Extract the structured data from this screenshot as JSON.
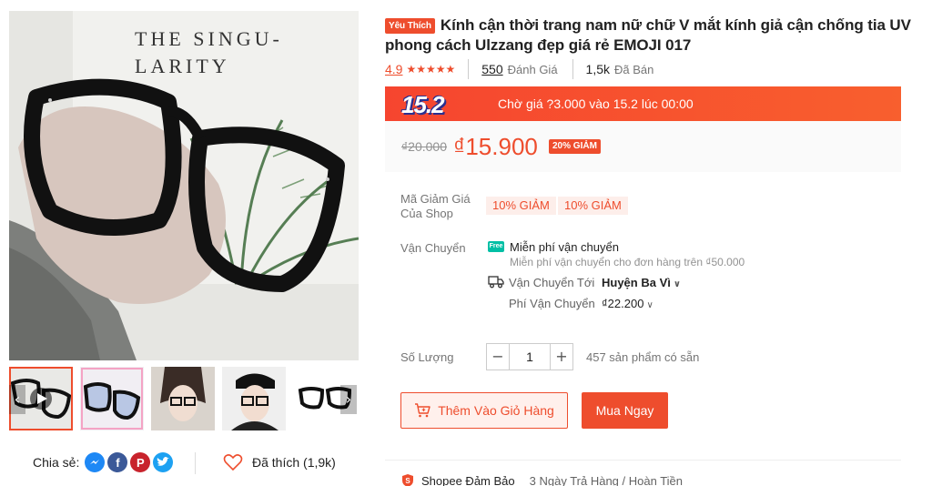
{
  "product": {
    "badge": "Yêu Thích",
    "title": "Kính cận thời trang nam nữ chữ V mắt kính giả cận chống tia UV phong cách Ulzzang đẹp giá rẻ EMOJI 017",
    "rating": "4.9",
    "stars": "★★★★★",
    "rating_count": "550",
    "rating_count_label": "Đánh Giá",
    "sold_count": "1,5k",
    "sold_label": "Đã Bán"
  },
  "gallery": {
    "book_title_line1": "THE SINGU-",
    "book_title_line2": "LARITY",
    "thumb_prev_icon": "chevron-left-icon",
    "thumb_next_icon": "chevron-right-icon",
    "play_icon": "play-icon"
  },
  "flash_sale": {
    "logo": "15.2",
    "text": "Chờ giá ?3.000 vào 15.2 lúc 00:00"
  },
  "price": {
    "original": "₫20.000",
    "current": "₫15.900",
    "discount_badge": "20% GIẢM"
  },
  "vouchers": {
    "label": "Mã Giảm Giá Của Shop",
    "items": [
      "10% GIẢM",
      "10% GIẢM"
    ]
  },
  "shipping": {
    "label": "Vận Chuyển",
    "free_icon": "Free",
    "free_title": "Miễn phí vận chuyển",
    "free_subtitle": "Miễn phí vận chuyển cho đơn hàng trên ₫50.000",
    "to_label": "Vận Chuyển Tới",
    "to_value": "Huyện Ba Vì",
    "fee_label": "Phí Vận Chuyển",
    "fee_value": "₫22.200",
    "chevron": "∨"
  },
  "quantity": {
    "label": "Số Lượng",
    "minus": "−",
    "value": "1",
    "plus": "+",
    "stock_text": "457 sản phẩm có sẵn"
  },
  "actions": {
    "add_to_cart": "Thêm Vào Giỏ Hàng",
    "buy_now": "Mua Ngay"
  },
  "share": {
    "label": "Chia sẻ:",
    "like_text": "Đã thích (1,9k)"
  },
  "guarantee": {
    "label": "Shopee Đảm Bảo",
    "desc": "3 Ngày Trả Hàng / Hoàn Tiền"
  },
  "colors": {
    "accent": "#ee4d2d",
    "messenger": "#1e88f5",
    "facebook": "#3b5998",
    "pinterest": "#c8232c",
    "twitter": "#1da1f2",
    "free_ship": "#00bfa5"
  }
}
